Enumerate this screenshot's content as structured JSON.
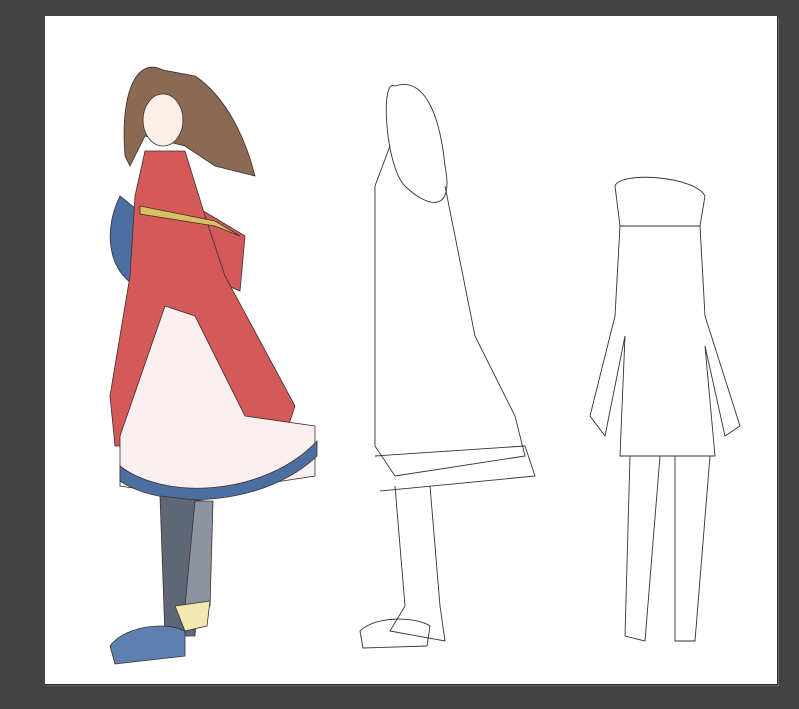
{
  "workspace": {
    "background_color": "#424242"
  },
  "canvas": {
    "background_color": "#ffffff",
    "artwork": {
      "figures": [
        "colored-front-view",
        "lineart-side-view",
        "lineart-back-view"
      ],
      "colors": {
        "hair": "#8a6a55",
        "dress": "#d45a5a",
        "underskirt": "#fbeeee",
        "hem": "#4a6fa0",
        "trim": "#d9c060",
        "stockings": "#5f6776",
        "shoes": "#5d80b0",
        "skin": "#fbefe8",
        "lineart": "#3a3030"
      }
    }
  }
}
